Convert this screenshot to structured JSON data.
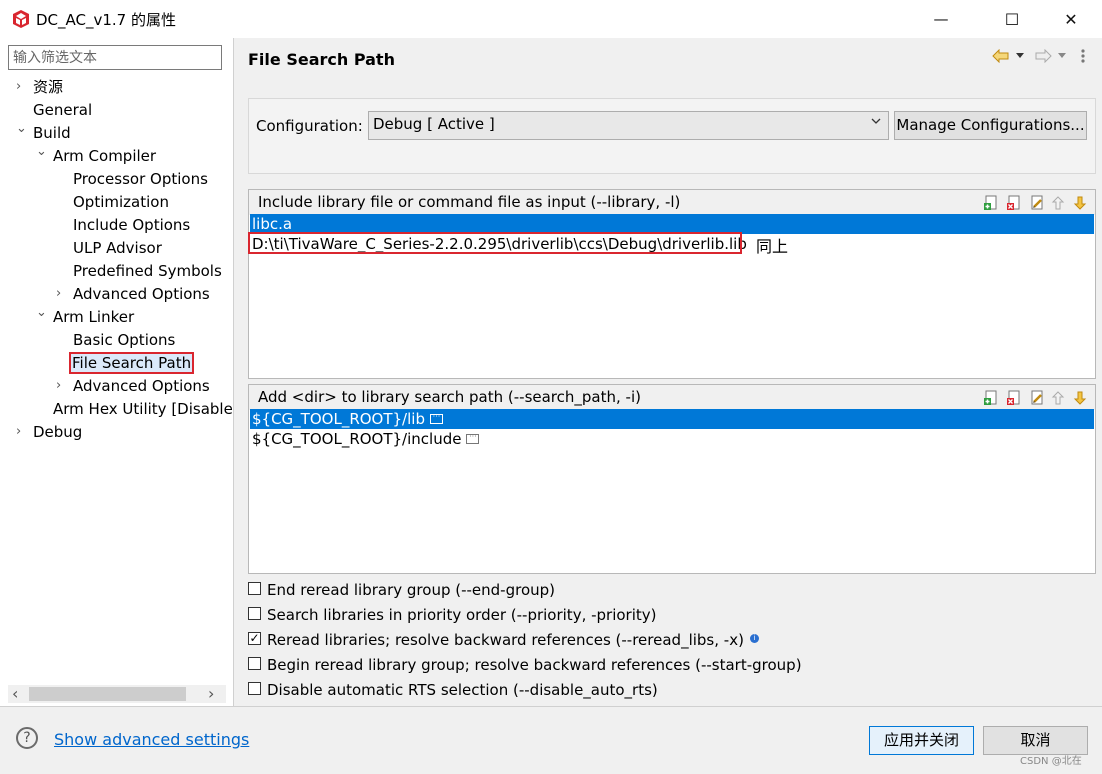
{
  "window": {
    "title": "DC_AC_v1.7 的属性",
    "minimize_glyph": "—",
    "maximize_glyph": "☐",
    "close_glyph": "✕"
  },
  "sidebar": {
    "filter_placeholder": "输入筛选文本",
    "items": [
      {
        "label": "资源",
        "chevron": "›"
      },
      {
        "label": "General",
        "chevron": ""
      },
      {
        "label": "Build",
        "chevron": "⌄"
      },
      {
        "label": "Arm Compiler",
        "chevron": "⌄"
      },
      {
        "label": "Processor Options",
        "chevron": ""
      },
      {
        "label": "Optimization",
        "chevron": ""
      },
      {
        "label": "Include Options",
        "chevron": ""
      },
      {
        "label": "ULP Advisor",
        "chevron": ""
      },
      {
        "label": "Predefined Symbols",
        "chevron": ""
      },
      {
        "label": "Advanced Options",
        "chevron": "›"
      },
      {
        "label": "Arm Linker",
        "chevron": "⌄"
      },
      {
        "label": "Basic Options",
        "chevron": ""
      },
      {
        "label": "File Search Path",
        "chevron": ""
      },
      {
        "label": "Advanced Options",
        "chevron": "›"
      },
      {
        "label": "Arm Hex Utility  [Disabled]",
        "chevron": ""
      },
      {
        "label": "Debug",
        "chevron": "›"
      }
    ],
    "scroll_left": "‹",
    "scroll_right": "›"
  },
  "page": {
    "title": "File Search Path",
    "configuration_label": "Configuration:",
    "configuration_value": "Debug  [ Active ]",
    "manage_button": "Manage Configurations..."
  },
  "library_group": {
    "title": "Include library file or command file as input (--library, -l)",
    "rows": [
      "libc.a",
      "D:\\ti\\TivaWare_C_Series-2.2.0.295\\driverlib\\ccs\\Debug\\driverlib.lib"
    ],
    "annotation": "同上"
  },
  "search_group": {
    "title": "Add <dir> to library search path (--search_path, -i)",
    "rows": [
      "${CG_TOOL_ROOT}/lib",
      "${CG_TOOL_ROOT}/include"
    ]
  },
  "checkboxes": [
    {
      "label": "End reread library group (--end-group)",
      "checked": false
    },
    {
      "label": "Search libraries in priority order (--priority, -priority)",
      "checked": false
    },
    {
      "label": "Reread libraries; resolve backward references (--reread_libs, -x)",
      "checked": true
    },
    {
      "label": "Begin reread library group; resolve backward references (--start-group)",
      "checked": false
    },
    {
      "label": "Disable automatic RTS selection (--disable_auto_rts)",
      "checked": false
    }
  ],
  "footer": {
    "help_glyph": "?",
    "advanced_link": "Show advanced settings",
    "apply_button": "应用并关闭",
    "cancel_button": "取消",
    "watermark": "CSDN @北在"
  },
  "colors": {
    "selection": "#0078d7",
    "highlight_box": "#d9262f",
    "link": "#0066cc"
  }
}
